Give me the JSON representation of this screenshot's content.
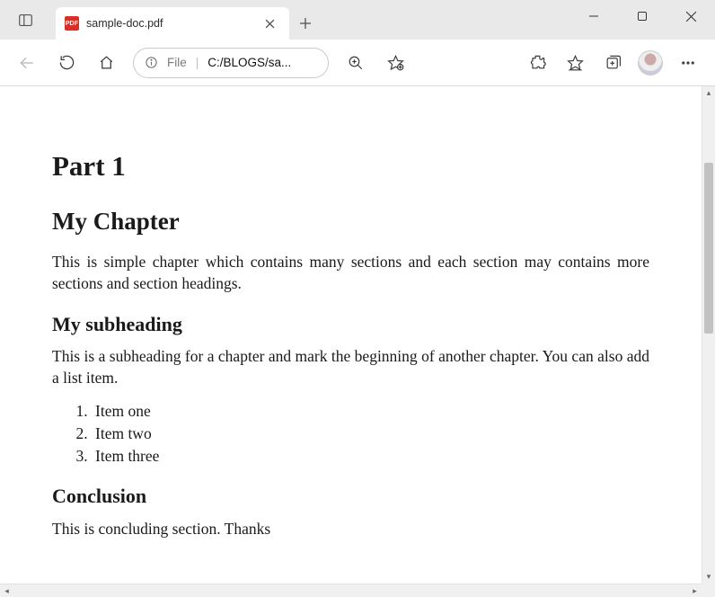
{
  "window": {
    "tab_title": "sample-doc.pdf",
    "favicon_label": "PDF"
  },
  "addressbar": {
    "scheme_label": "File",
    "path_display": "C:/BLOGS/sa..."
  },
  "document": {
    "part_heading": "Part 1",
    "chapter_heading": "My Chapter",
    "chapter_paragraph": "This is simple chapter which contains many sections and each section may contains more sections and section headings.",
    "subheading": "My subheading",
    "subheading_paragraph": "This is a subheading for a chapter and mark the beginning of another chapter. You can also add a list item.",
    "list_items": [
      "Item one",
      "Item two",
      "Item three"
    ],
    "conclusion_heading": "Conclusion",
    "conclusion_paragraph": "This is concluding section.  Thanks"
  }
}
